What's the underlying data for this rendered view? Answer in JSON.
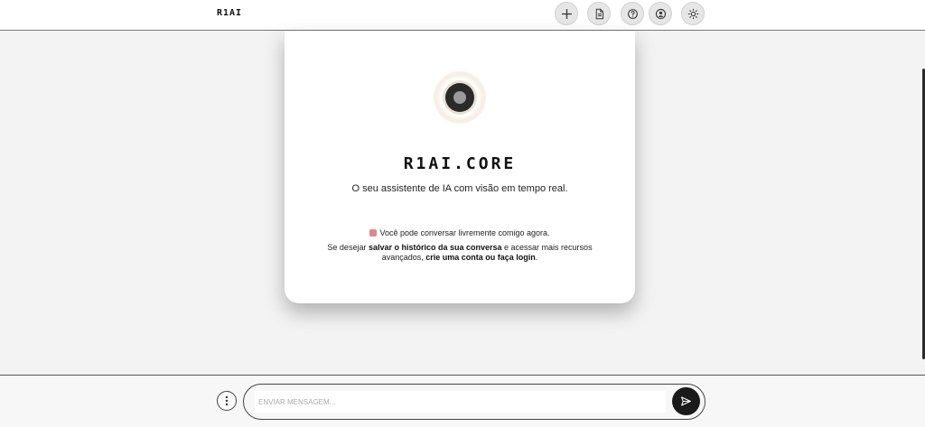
{
  "header": {
    "brand": "R1AI",
    "buttons": [
      {
        "icon": "plus-icon"
      },
      {
        "icon": "document-icon"
      },
      {
        "icon": "help-icon"
      },
      {
        "icon": "user-icon"
      },
      {
        "icon": "sun-icon"
      }
    ]
  },
  "welcome": {
    "title": "R1AI.CORE",
    "subtitle": "O seu assistente de IA com visão em tempo real.",
    "info_line": "Você pode conversar livremente comigo agora.",
    "login_prefix": "Se desejar ",
    "login_bold_1": "salvar o histórico da sua conversa",
    "login_middle": " e acessar mais recursos avançados, ",
    "login_bold_2": "crie uma conta ou faça login",
    "login_suffix": "."
  },
  "composer": {
    "placeholder": "ENVIAR MENSAGEM...",
    "value": ""
  },
  "colors": {
    "background": "#f3f3f3",
    "card": "#ffffff",
    "send_button": "#1a1a1a"
  }
}
